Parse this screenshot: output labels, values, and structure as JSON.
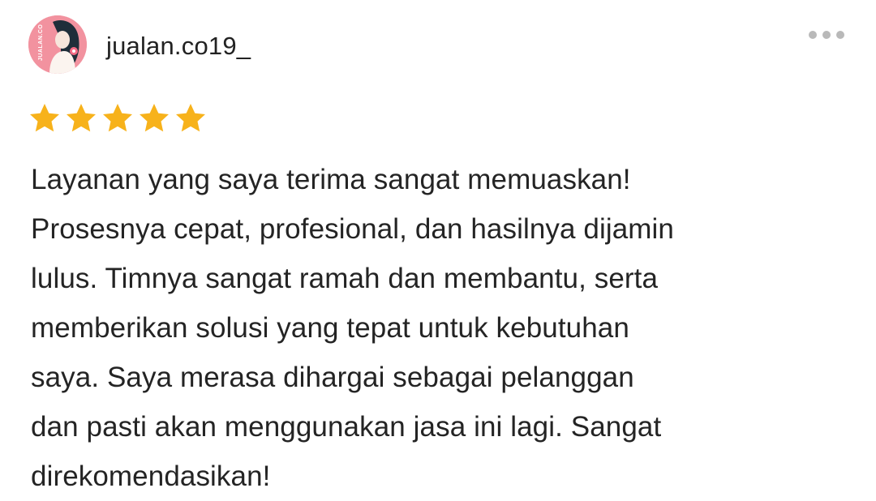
{
  "review": {
    "username": "jualan.co19_",
    "avatar_label": "JUALAN.CO",
    "more_icon": "more-horizontal-icon",
    "rating": 5,
    "rating_max": 5,
    "star_color": "#f7b21b",
    "text_lines": [
      "Layanan yang saya terima sangat memuaskan!",
      "Prosesnya cepat, profesional, dan hasilnya dijamin",
      "lulus. Timnya sangat ramah dan membantu, serta",
      "memberikan solusi yang tepat untuk kebutuhan",
      "saya. Saya merasa dihargai sebagai pelanggan",
      "dan pasti akan menggunakan jasa ini lagi. Sangat",
      "direkomendasikan!"
    ]
  }
}
